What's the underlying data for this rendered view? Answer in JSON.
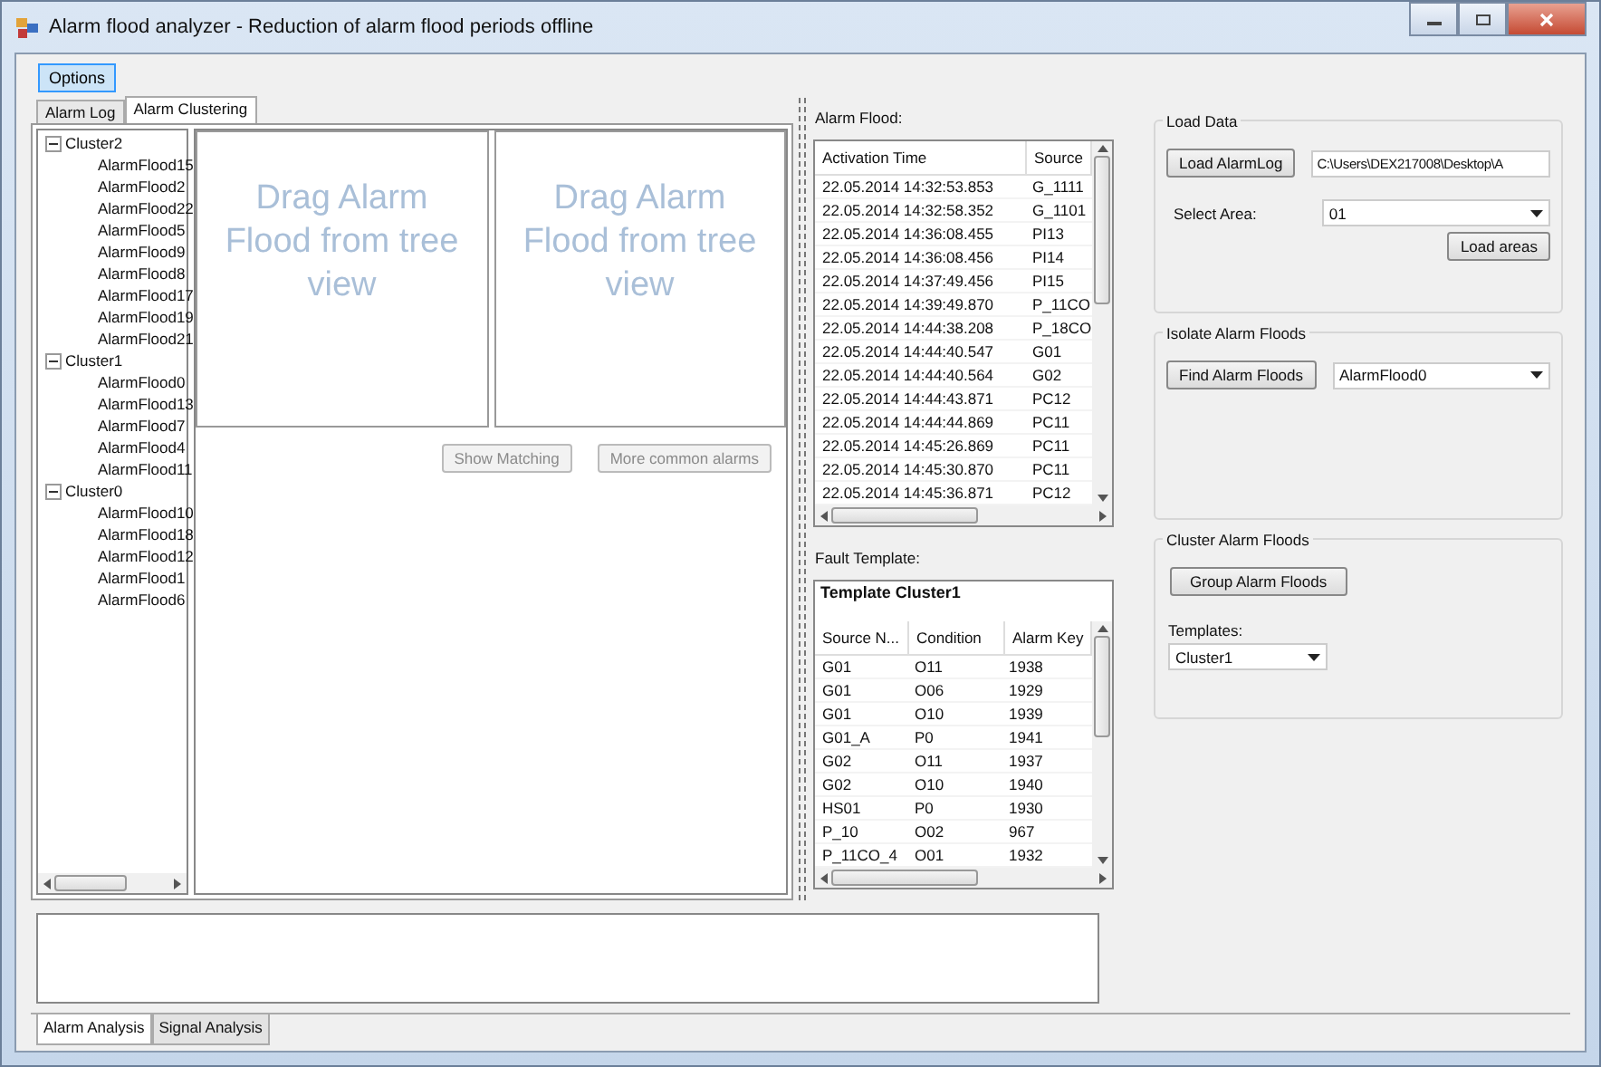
{
  "window": {
    "title": "Alarm flood analyzer - Reduction of alarm flood periods offline"
  },
  "options_button": {
    "label": "Options",
    "highlighted": true
  },
  "left_tabs": [
    {
      "label": "Alarm Log",
      "selected": false
    },
    {
      "label": "Alarm Clustering",
      "selected": true
    }
  ],
  "tree": [
    {
      "label": "Cluster2",
      "expanded": true,
      "children": [
        {
          "label": "AlarmFlood15"
        },
        {
          "label": "AlarmFlood2"
        },
        {
          "label": "AlarmFlood22"
        },
        {
          "label": "AlarmFlood5"
        },
        {
          "label": "AlarmFlood9"
        },
        {
          "label": "AlarmFlood8"
        },
        {
          "label": "AlarmFlood17"
        },
        {
          "label": "AlarmFlood19"
        },
        {
          "label": "AlarmFlood21"
        }
      ]
    },
    {
      "label": "Cluster1",
      "expanded": true,
      "children": [
        {
          "label": "AlarmFlood0"
        },
        {
          "label": "AlarmFlood13"
        },
        {
          "label": "AlarmFlood7"
        },
        {
          "label": "AlarmFlood4"
        },
        {
          "label": "AlarmFlood11"
        }
      ]
    },
    {
      "label": "Cluster0",
      "expanded": true,
      "children": [
        {
          "label": "AlarmFlood10"
        },
        {
          "label": "AlarmFlood18"
        },
        {
          "label": "AlarmFlood12"
        },
        {
          "label": "AlarmFlood1"
        },
        {
          "label": "AlarmFlood6"
        }
      ]
    }
  ],
  "drop_zones": [
    "Drag Alarm Flood from tree view",
    "Drag Alarm Flood from tree view"
  ],
  "compare_buttons": [
    {
      "label": "Show Matching",
      "disabled": true
    },
    {
      "label": "More common alarms",
      "disabled": true
    }
  ],
  "alarm_flood": {
    "label": "Alarm Flood:",
    "columns": [
      "Activation Time",
      "Source"
    ],
    "rows": [
      [
        "22.05.2014  14:32:53.853",
        "G_1111"
      ],
      [
        "22.05.2014  14:32:58.352",
        "G_1101"
      ],
      [
        "22.05.2014  14:36:08.455",
        "PI13"
      ],
      [
        "22.05.2014  14:36:08.456",
        "PI14"
      ],
      [
        "22.05.2014  14:37:49.456",
        "PI15"
      ],
      [
        "22.05.2014  14:39:49.870",
        "P_11CO"
      ],
      [
        "22.05.2014  14:44:38.208",
        "P_18CO"
      ],
      [
        "22.05.2014  14:44:40.547",
        "G01"
      ],
      [
        "22.05.2014  14:44:40.564",
        "G02"
      ],
      [
        "22.05.2014  14:44:43.871",
        "PC12"
      ],
      [
        "22.05.2014  14:44:44.869",
        "PC11"
      ],
      [
        "22.05.2014  14:45:26.869",
        "PC11"
      ],
      [
        "22.05.2014  14:45:30.870",
        "PC11"
      ],
      [
        "22.05.2014  14:45:36.871",
        "PC12"
      ]
    ]
  },
  "fault_template": {
    "label": "Fault Template:",
    "title": "Template Cluster1",
    "columns": [
      "Source N...",
      "Condition",
      "Alarm Key"
    ],
    "rows": [
      [
        "G01",
        "O11",
        "1938"
      ],
      [
        "G01",
        "O06",
        "1929"
      ],
      [
        "G01",
        "O10",
        "1939"
      ],
      [
        "G01_A",
        "P0",
        "1941"
      ],
      [
        "G02",
        "O11",
        "1937"
      ],
      [
        "G02",
        "O10",
        "1940"
      ],
      [
        "HS01",
        "P0",
        "1930"
      ],
      [
        "P_10",
        "O02",
        "967"
      ],
      [
        "P_11CO_4",
        "O01",
        "1932"
      ]
    ]
  },
  "load_data": {
    "title": "Load Data",
    "load_button": "Load AlarmLog",
    "path": "C:\\Users\\DEX217008\\Desktop\\A",
    "area_label": "Select Area:",
    "area_value": "01",
    "areas_button": "Load areas"
  },
  "isolate": {
    "title": "Isolate Alarm Floods",
    "find_button": "Find Alarm Floods",
    "flood_value": "AlarmFlood0"
  },
  "cluster": {
    "title": "Cluster Alarm Floods",
    "group_button": "Group Alarm Floods",
    "templates_label": "Templates:",
    "templates_value": "Cluster1"
  },
  "bottom_tabs": [
    {
      "label": "Alarm Analysis",
      "selected": true
    },
    {
      "label": "Signal Analysis",
      "selected": false
    }
  ]
}
